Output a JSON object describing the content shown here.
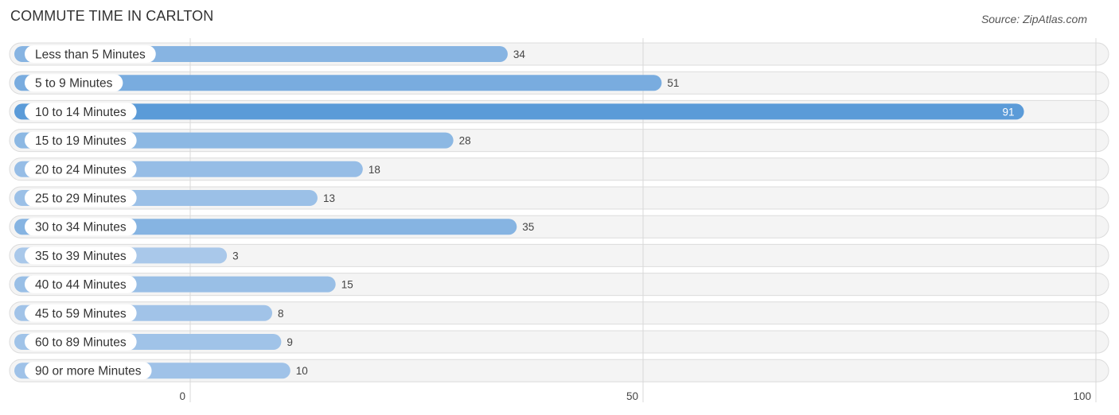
{
  "header": {
    "title": "COMMUTE TIME IN CARLTON",
    "source": "Source: ZipAtlas.com"
  },
  "chart_data": {
    "type": "bar",
    "orientation": "horizontal",
    "title": "COMMUTE TIME IN CARLTON",
    "source": "Source: ZipAtlas.com",
    "categories": [
      "Less than 5 Minutes",
      "5 to 9 Minutes",
      "10 to 14 Minutes",
      "15 to 19 Minutes",
      "20 to 24 Minutes",
      "25 to 29 Minutes",
      "30 to 34 Minutes",
      "35 to 39 Minutes",
      "40 to 44 Minutes",
      "45 to 59 Minutes",
      "60 to 89 Minutes",
      "90 or more Minutes"
    ],
    "values": [
      34,
      51,
      91,
      28,
      18,
      13,
      35,
      3,
      15,
      8,
      9,
      10
    ],
    "xlabel": "",
    "ylabel": "",
    "xlim": [
      0,
      100
    ],
    "xticks": [
      0,
      50,
      100
    ],
    "grid": true,
    "legend": "none",
    "colors": {
      "bar_max": "#5b9bd8",
      "bar_min": "#a9c8ea",
      "track": "#f4f4f4"
    },
    "highlighted_category": "10 to 14 Minutes"
  }
}
